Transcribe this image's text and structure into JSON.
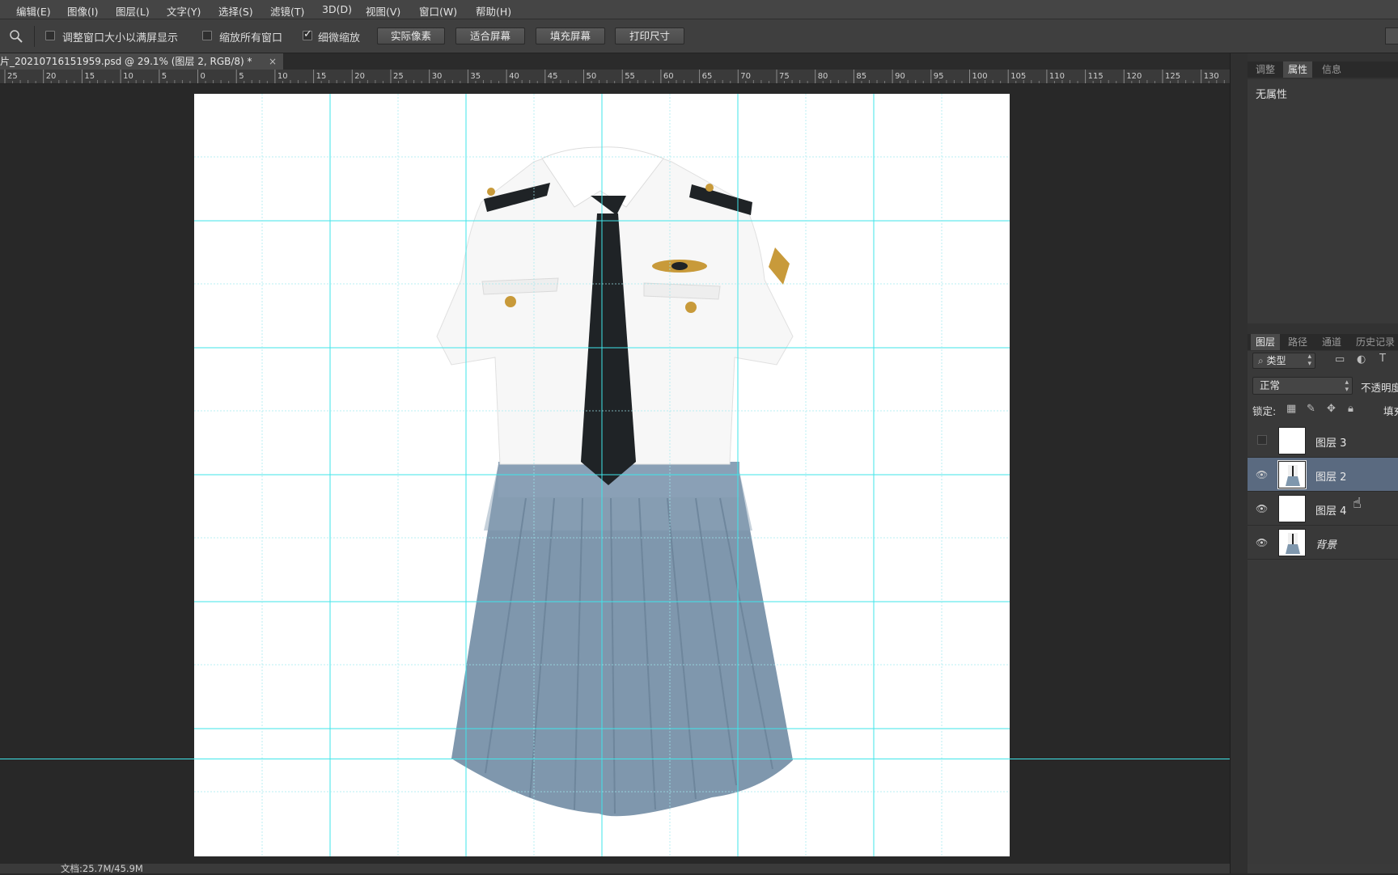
{
  "menu": [
    "编辑(E)",
    "图像(I)",
    "图层(L)",
    "文字(Y)",
    "选择(S)",
    "滤镜(T)",
    "3D(D)",
    "视图(V)",
    "窗口(W)",
    "帮助(H)"
  ],
  "options": {
    "check1_label": "调整窗口大小以满屏显示",
    "check1_on": false,
    "check2_label": "缩放所有窗口",
    "check2_on": false,
    "check3_label": "细微缩放",
    "check3_on": true,
    "btn_actual": "实际像素",
    "btn_fit": "适合屏幕",
    "btn_fill": "填充屏幕",
    "btn_print": "打印尺寸"
  },
  "document": {
    "tab_title": "片_20210716151959.psd @ 29.1% (图层 2, RGB/8) *",
    "close": "×",
    "status": "文档:25.7M/45.9M",
    "zoom_percent": 29.1
  },
  "ruler": {
    "labels": [
      "25",
      "20",
      "15",
      "10",
      "5",
      "0",
      "5",
      "10",
      "15",
      "20",
      "25",
      "30",
      "35",
      "40",
      "45",
      "50",
      "55",
      "60",
      "65",
      "70",
      "75",
      "80",
      "85",
      "90",
      "95",
      "100",
      "105",
      "110",
      "115",
      "120",
      "125",
      "130"
    ]
  },
  "properties_panel": {
    "tabs": [
      "调整",
      "属性",
      "信息"
    ],
    "active_tab": "属性",
    "content": "无属性"
  },
  "layers_panel": {
    "tabs": [
      "图层",
      "路径",
      "通道",
      "历史记录"
    ],
    "active_tab": "图层",
    "filter_kind": "类型",
    "blend_mode": "正常",
    "opacity_label": "不透明度",
    "lock_label": "锁定:",
    "fill_label": "填充",
    "layers": [
      {
        "name": "图层 3",
        "visible": false,
        "selected": false,
        "thumb": "transparent"
      },
      {
        "name": "图层 2",
        "visible": true,
        "selected": true,
        "thumb": "uniform"
      },
      {
        "name": "图层 4",
        "visible": true,
        "selected": false,
        "thumb": "white"
      },
      {
        "name": "背景",
        "visible": true,
        "selected": false,
        "thumb": "uniform"
      }
    ]
  },
  "colors": {
    "guide": "#3fe6ea",
    "selected_layer": "#5a6a80",
    "shirt": "#f7f7f7",
    "tie": "#1f2326",
    "skirt": "#7f97ad"
  }
}
